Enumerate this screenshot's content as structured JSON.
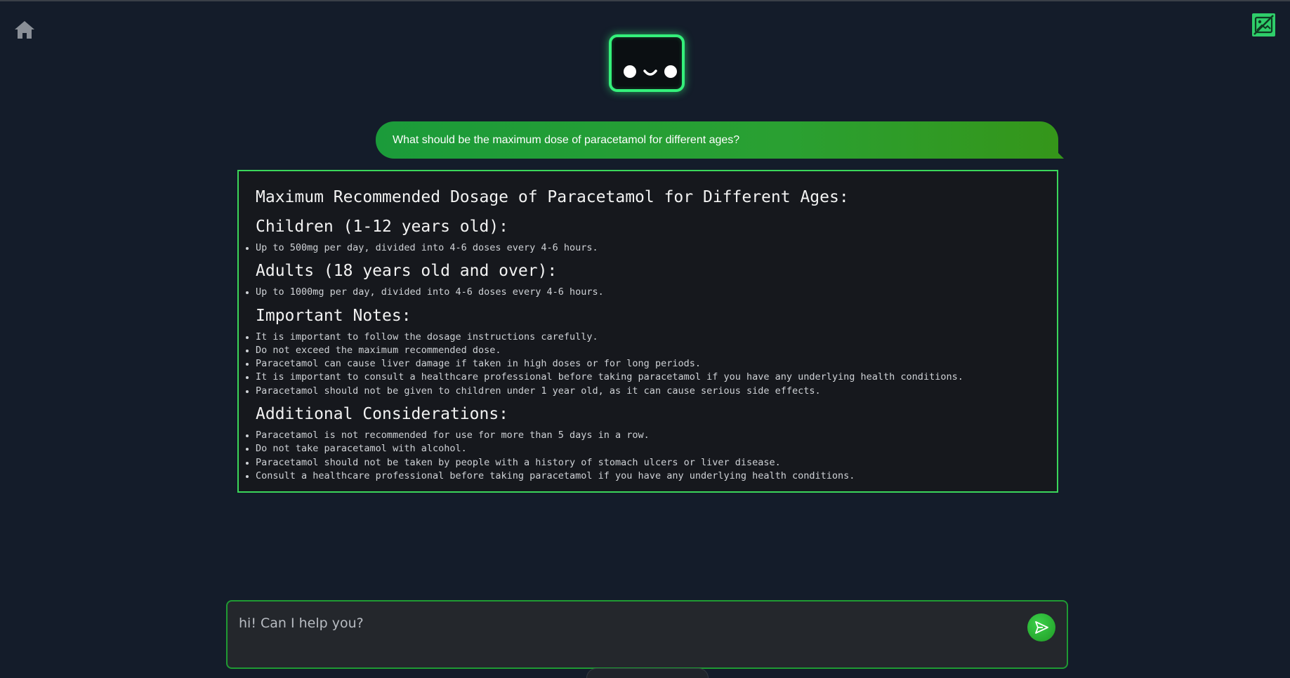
{
  "nav": {
    "home_icon": "home-icon",
    "corner_icon": "image-off-icon"
  },
  "colors": {
    "background": "#141c2a",
    "accent": "#34f07a",
    "bubble": "#1b9b3a",
    "border": "#3bd65a"
  },
  "chat": {
    "user_message": "What should be the maximum dose of paracetamol for different ages?",
    "reply": {
      "title": "Maximum Recommended Dosage of Paracetamol for Different Ages:",
      "sections": [
        {
          "heading": "Children (1-12 years old):",
          "items": [
            "Up to 500mg per day, divided into 4-6 doses every 4-6 hours."
          ]
        },
        {
          "heading": "Adults (18 years old and over):",
          "items": [
            "Up to 1000mg per day, divided into 4-6 doses every 4-6 hours."
          ]
        },
        {
          "heading": "Important Notes:",
          "items": [
            "It is important to follow the dosage instructions carefully.",
            "Do not exceed the maximum recommended dose.",
            "Paracetamol can cause liver damage if taken in high doses or for long periods.",
            "It is important to consult a healthcare professional before taking paracetamol if you have any underlying health conditions.",
            "Paracetamol should not be given to children under 1 year old, as it can cause serious side effects."
          ]
        },
        {
          "heading": "Additional Considerations:",
          "items": [
            "Paracetamol is not recommended for use for more than 5 days in a row.",
            "Do not take paracetamol with alcohol.",
            "Paracetamol should not be taken by people with a history of stomach ulcers or liver disease.",
            "Consult a healthcare professional before taking paracetamol if you have any underlying health conditions."
          ]
        }
      ]
    }
  },
  "composer": {
    "placeholder": "hi! Can I help you?",
    "value": "",
    "send_icon": "send-icon"
  }
}
